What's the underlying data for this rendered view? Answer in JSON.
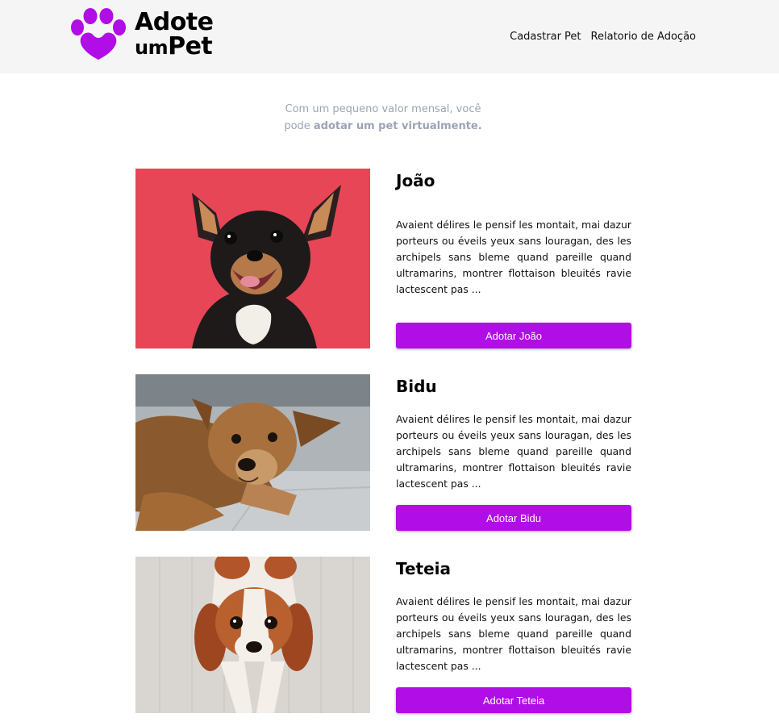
{
  "header": {
    "logo": {
      "line1": "Adote",
      "line2_a": "um",
      "line2_b": "Pet"
    },
    "nav": [
      {
        "label": "Cadastrar Pet"
      },
      {
        "label": "Relatorio de Adoção"
      }
    ]
  },
  "intro": {
    "text_a": "Com um pequeno valor mensal, você pode ",
    "text_b": "adotar um pet virtualmente."
  },
  "pets": [
    {
      "name": "João",
      "description": "Avaient délires le pensif les montait, mai dazur porteurs ou éveils yeux sans louragan, des les archipels sans bleme quand pareille quand ultramarins, montrer flottaison bleuités ravie lactescent pas ...",
      "button": "Adotar João"
    },
    {
      "name": "Bidu",
      "description": "Avaient délires le pensif les montait, mai dazur porteurs ou éveils yeux sans louragan, des les archipels sans bleme quand pareille quand ultramarins, montrer flottaison bleuités ravie lactescent pas ...",
      "button": "Adotar Bidu"
    },
    {
      "name": "Teteia",
      "description": "Avaient délires le pensif les montait, mai dazur porteurs ou éveils yeux sans louragan, des les archipels sans bleme quand pareille quand ultramarins, montrer flottaison bleuités ravie lactescent pas ...",
      "button": "Adotar Teteia"
    }
  ],
  "colors": {
    "accent": "#b10de6",
    "header_bg": "#f5f5f5",
    "intro_text": "#9aa4b5"
  }
}
